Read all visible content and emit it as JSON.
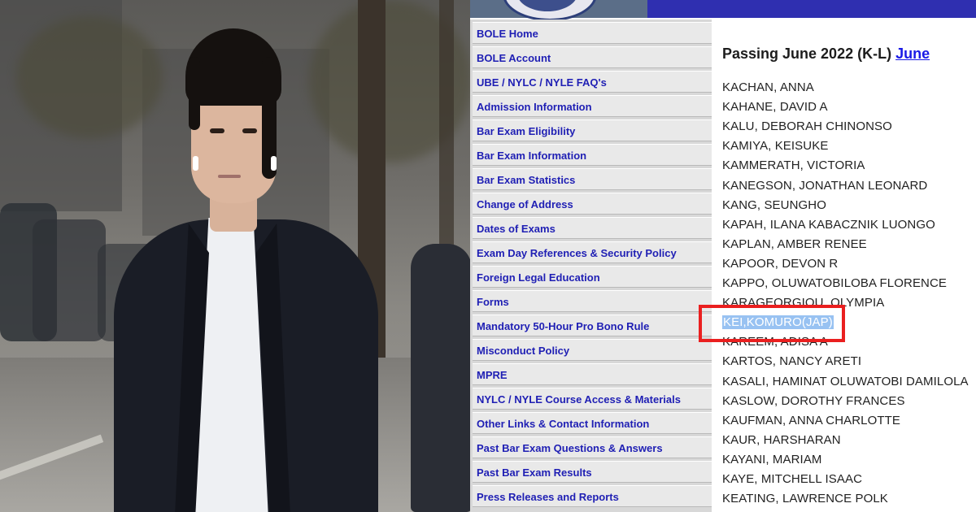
{
  "sidebar": {
    "items": [
      {
        "label": "BOLE Home"
      },
      {
        "label": "BOLE Account"
      },
      {
        "label": "UBE / NYLC / NYLE FAQ's"
      },
      {
        "label": "Admission Information"
      },
      {
        "label": "Bar Exam Eligibility"
      },
      {
        "label": "Bar Exam Information"
      },
      {
        "label": "Bar Exam Statistics"
      },
      {
        "label": "Change of Address"
      },
      {
        "label": "Dates of Exams"
      },
      {
        "label": "Exam Day References & Security Policy"
      },
      {
        "label": "Foreign Legal Education"
      },
      {
        "label": "Forms"
      },
      {
        "label": "Mandatory 50-Hour Pro Bono Rule"
      },
      {
        "label": "Misconduct Policy"
      },
      {
        "label": "MPRE"
      },
      {
        "label": "NYLC / NYLE Course Access & Materials"
      },
      {
        "label": "Other Links & Contact Information"
      },
      {
        "label": "Past Bar Exam Questions & Answers"
      },
      {
        "label": "Past Bar Exam Results"
      },
      {
        "label": "Press Releases and Reports"
      }
    ]
  },
  "main": {
    "heading": "Passing June 2022 (K-L) ",
    "heading_link": "June",
    "names": [
      "KACHAN, ANNA",
      "KAHANE, DAVID A",
      "KALU, DEBORAH CHINONSO",
      "KAMIYA, KEISUKE",
      "KAMMERATH, VICTORIA",
      "KANEGSON, JONATHAN LEONARD",
      "KANG, SEUNGHO",
      "KAPAH, ILANA KABACZNIK LUONGO",
      "KAPLAN, AMBER RENEE",
      "KAPOOR, DEVON R",
      "KAPPO, OLUWATOBILOBA FLORENCE",
      "KARAGEORGIOU, OLYMPIA",
      "KEI,KOMURO(JAP)",
      "KAREEM, ADISA A",
      "KARTOS, NANCY ARETI",
      "KASALI, HAMINAT OLUWATOBI DAMILOLA",
      "KASLOW, DOROTHY FRANCES",
      "KAUFMAN, ANNA CHARLOTTE",
      "KAUR, HARSHARAN",
      "KAYANI, MARIAM",
      "KAYE, MITCHELL ISAAC",
      "KEATING, LAWRENCE POLK"
    ],
    "highlighted_name": "KEI,KOMURO(JAP)"
  },
  "colors": {
    "nav_link": "#1f1fb4",
    "highlight": "#98c2f2",
    "annotation_box": "#ea1f1f",
    "banner": "#2f2fb0"
  }
}
